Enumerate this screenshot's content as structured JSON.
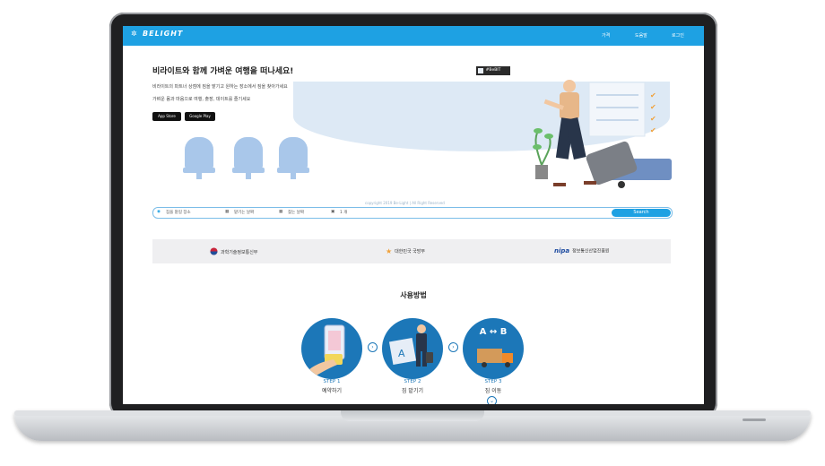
{
  "header": {
    "logo_text": "BELIGHT",
    "nav": [
      "가격",
      "도움말",
      "로그인"
    ]
  },
  "hero": {
    "title": "비라이트와 함께 가벼운 여행을 떠나세요!",
    "line1": "비라이트의 파트너 상점에 짐을 맡기고 원하는 장소에서 짐을 찾아가세요",
    "line2": "가벼운 몸과 마음으로 여행, 출장, 데이트를 즐기세요",
    "hashtag": "#BeBIT",
    "app_store": "App Store",
    "google_play": "Google Play"
  },
  "search": {
    "copyright": "copyright 2019 Be-Light | All Right Reserved",
    "place_placeholder": "짐을 맡길 장소",
    "from_date": "맡기는 날짜",
    "to_date": "찾는 날짜",
    "count": "1 개",
    "button": "Search"
  },
  "partners": [
    "과학기술정보통신부",
    "대한민국 국방부",
    "정보통신산업진흥원"
  ],
  "howto": {
    "title": "사용방법",
    "steps": [
      {
        "label": "STEP 1",
        "name": "예약하기"
      },
      {
        "label": "STEP 2",
        "name": "짐 맡기기"
      },
      {
        "label": "STEP 3",
        "name": "짐 이동"
      }
    ],
    "step3_icon_text": "A ↔ B"
  },
  "colors": {
    "brand_blue": "#1ea1e3",
    "step_blue": "#1c77b8",
    "chair_blue": "#a9c7ea"
  }
}
